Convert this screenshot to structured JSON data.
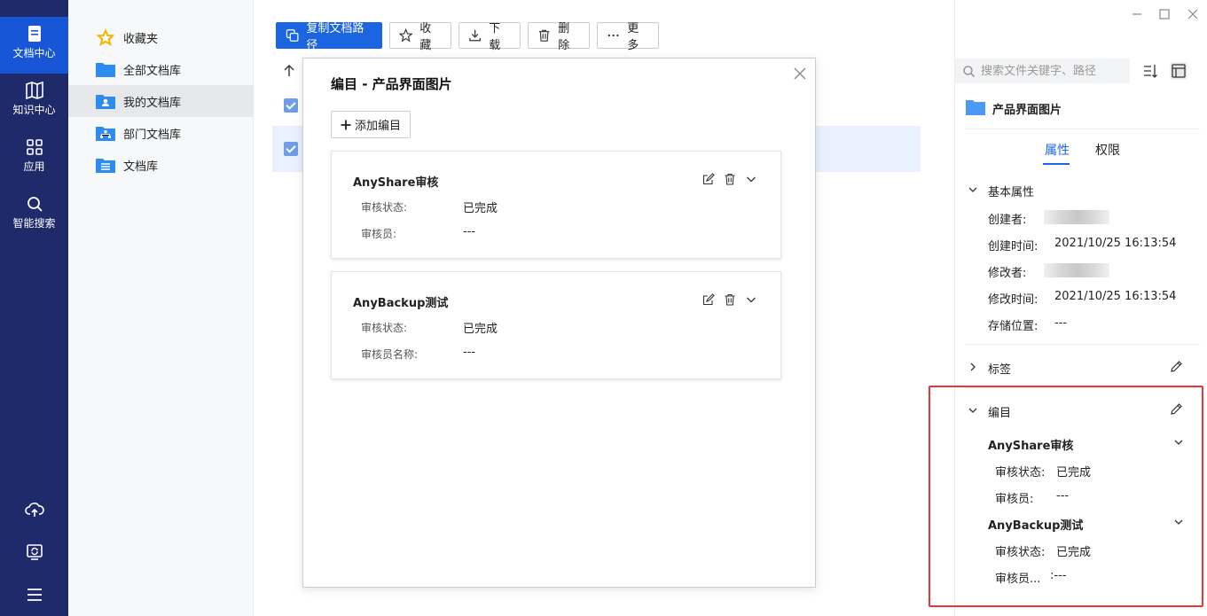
{
  "rail": {
    "items": [
      {
        "label": "文档中心",
        "icon": "document-icon"
      },
      {
        "label": "知识中心",
        "icon": "book-icon"
      },
      {
        "label": "应用",
        "icon": "apps-grid-icon"
      },
      {
        "label": "智能搜索",
        "icon": "search-icon"
      }
    ],
    "bottom_icons": [
      "cloud-upload-icon",
      "sync-screen-icon",
      "menu-icon"
    ]
  },
  "library": {
    "items": [
      {
        "label": "收藏夹",
        "icon": "star-icon"
      },
      {
        "label": "全部文档库",
        "icon": "folder-icon"
      },
      {
        "label": "我的文档库",
        "icon": "user-folder-icon"
      },
      {
        "label": "部门文档库",
        "icon": "org-folder-icon"
      },
      {
        "label": "文档库",
        "icon": "list-folder-icon"
      }
    ]
  },
  "toolbar": {
    "copy_path": "复制文档路径",
    "favorite": "收藏",
    "download": "下载",
    "delete": "删除",
    "more": "更多"
  },
  "modal": {
    "title": "编目 - 产品界面图片",
    "add_button": "添加编目",
    "cards": [
      {
        "title": "AnyShare审核",
        "rows": [
          {
            "label": "审核状态:",
            "value": "已完成"
          },
          {
            "label": "审核员:",
            "value": "---"
          }
        ]
      },
      {
        "title": "AnyBackup测试",
        "rows": [
          {
            "label": "审核状态:",
            "value": "已完成"
          },
          {
            "label": "审核员名称:",
            "value": "---"
          }
        ]
      }
    ]
  },
  "right_pane": {
    "search_placeholder": "搜索文件关键字、路径",
    "file_name": "产品界面图片",
    "tabs": [
      "属性",
      "权限"
    ],
    "basic_section": "基本属性",
    "basic": [
      {
        "label": "创建者:",
        "value": ""
      },
      {
        "label": "创建时间:",
        "value": "2021/10/25 16:13:54"
      },
      {
        "label": "修改者:",
        "value": ""
      },
      {
        "label": "修改时间:",
        "value": "2021/10/25 16:13:54"
      },
      {
        "label": "存储位置:",
        "value": "---"
      }
    ],
    "tags_section": "标签",
    "catalog_section": "编目",
    "catalog": [
      {
        "title": "AnyShare审核",
        "rows": [
          {
            "label": "审核状态:",
            "value": "已完成"
          },
          {
            "label": "审核员:",
            "value": "---"
          }
        ]
      },
      {
        "title": "AnyBackup测试",
        "rows": [
          {
            "label": "审核状态:",
            "value": "已完成"
          },
          {
            "label": "审核员...",
            "value": ":---"
          }
        ]
      }
    ]
  },
  "colors": {
    "rail": "#1f2a6b",
    "rail_active": "#1756d6",
    "accent": "#1b66e0",
    "highlight": "#e53935"
  }
}
